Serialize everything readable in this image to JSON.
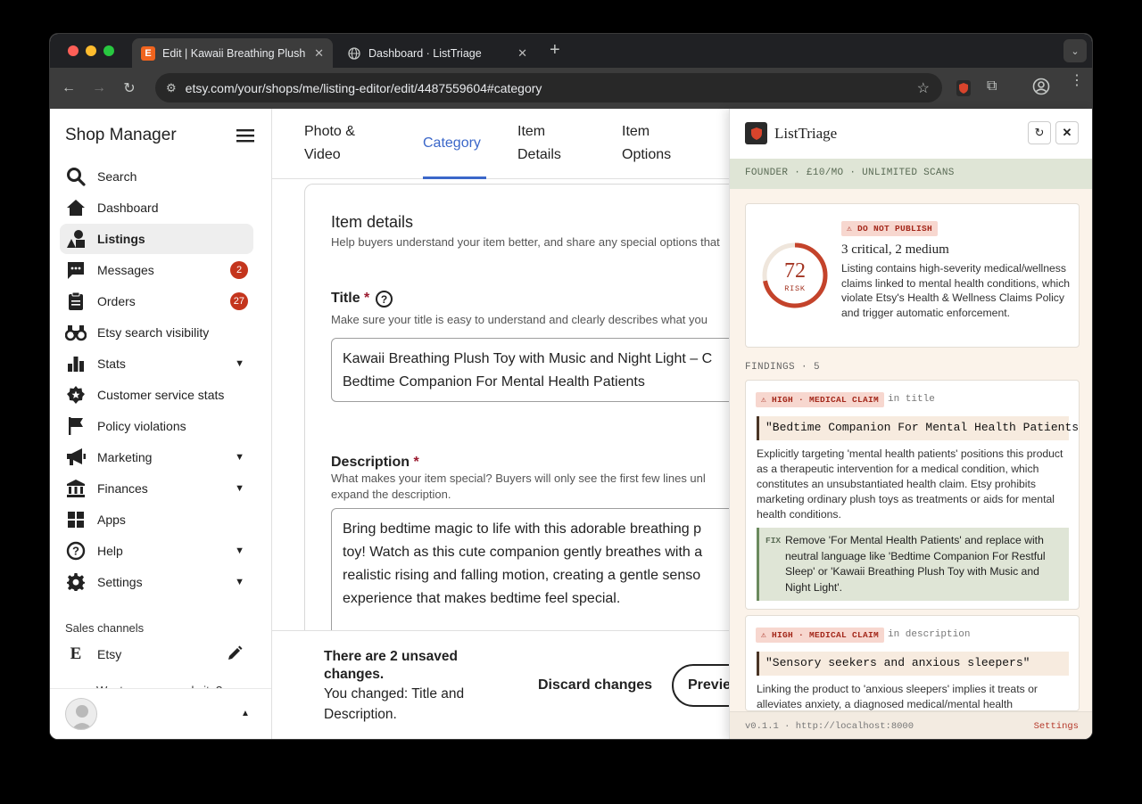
{
  "browser": {
    "tabs": [
      {
        "title": "Edit | Kawaii Breathing Plush T",
        "favicon": "E",
        "active": true
      },
      {
        "title": "Dashboard · ListTriage",
        "favicon": "globe",
        "active": false
      }
    ],
    "url": "etsy.com/your/shops/me/listing-editor/edit/4487559604#category"
  },
  "sidebar": {
    "title": "Shop Manager",
    "items": [
      {
        "label": "Search",
        "icon": "search-icon"
      },
      {
        "label": "Dashboard",
        "icon": "home-icon"
      },
      {
        "label": "Listings",
        "icon": "shapes-icon",
        "selected": true
      },
      {
        "label": "Messages",
        "icon": "message-icon",
        "badge": "2"
      },
      {
        "label": "Orders",
        "icon": "clipboard-icon",
        "badge": "27"
      },
      {
        "label": "Etsy search visibility",
        "icon": "binoculars-icon"
      },
      {
        "label": "Stats",
        "icon": "bar-chart-icon",
        "expandable": true
      },
      {
        "label": "Customer service stats",
        "icon": "badge-star-icon"
      },
      {
        "label": "Policy violations",
        "icon": "flag-icon"
      },
      {
        "label": "Marketing",
        "icon": "megaphone-icon",
        "expandable": true
      },
      {
        "label": "Finances",
        "icon": "bank-icon",
        "expandable": true
      },
      {
        "label": "Apps",
        "icon": "grid-icon"
      },
      {
        "label": "Help",
        "icon": "help-icon",
        "expandable": true
      },
      {
        "label": "Settings",
        "icon": "gear-icon",
        "expandable": true
      }
    ],
    "sales_channels_label": "Sales channels",
    "channel": "Etsy",
    "cut_text": "Want your own website?"
  },
  "editor": {
    "tabs": [
      "Photo & Video",
      "Category",
      "Item Details",
      "Item Options"
    ],
    "active_tab": "Category",
    "section_title": "Item details",
    "section_sub": "Help buyers understand your item better, and share any special options that",
    "title_label": "Title",
    "title_help": "Make sure your title is easy to understand and clearly describes what you",
    "title_value_line1": "Kawaii Breathing Plush Toy with Music and Night Light – C",
    "title_value_line2": "Bedtime Companion For Mental Health Patients",
    "desc_label": "Description",
    "desc_help_line1": "What makes your item special? Buyers will only see the first few lines unl",
    "desc_help_line2": "expand the description.",
    "desc_lines": [
      "Bring bedtime magic to life with this adorable breathing p",
      "toy! Watch as this cute companion gently breathes with a",
      "realistic rising and falling motion, creating a gentle senso",
      "experience that makes bedtime feel special."
    ],
    "unsaved_title": "There are 2 unsaved changes.",
    "unsaved_detail": "You changed: Title and Description.",
    "discard_label": "Discard changes",
    "preview_label": "Preview"
  },
  "panel": {
    "brand": "ListTriage",
    "plan": "FOUNDER · £10/MO · UNLIMITED SCANS",
    "risk_score": "72",
    "risk_label": "RISK",
    "risk_fraction": 0.72,
    "verdict_tag": "⚠ DO NOT PUBLISH",
    "summary_title": "3 critical, 2 medium",
    "summary_text": "Listing contains high-severity medical/wellness claims linked to mental health conditions, which violate Etsy's Health & Wellness Claims Policy and trigger automatic enforcement.",
    "findings_label": "FINDINGS · 5",
    "findings": [
      {
        "tag": "⚠ HIGH · MEDICAL CLAIM",
        "location": "in title",
        "quote": "\"Bedtime Companion For Mental Health Patients\"",
        "explanation": "Explicitly targeting 'mental health patients' positions this product as a therapeutic intervention for a medical condition, which constitutes an unsubstantiated health claim. Etsy prohibits marketing ordinary plush toys as treatments or aids for mental health conditions.",
        "fix_label": "FIX",
        "fix": "Remove 'For Mental Health Patients' and replace with neutral language like 'Bedtime Companion For Restful Sleep' or 'Kawaii Breathing Plush Toy with Music and Night Light'."
      },
      {
        "tag": "⚠ HIGH · MEDICAL CLAIM",
        "location": "in description",
        "quote": "\"Sensory seekers and anxious sleepers\"",
        "explanation": "Linking the product to 'anxious sleepers' implies it treats or alleviates anxiety, a diagnosed medical/mental health"
      }
    ],
    "version": "v0.1.1 · http://localhost:8000",
    "settings_label": "Settings",
    "accent": "#c4432b"
  }
}
